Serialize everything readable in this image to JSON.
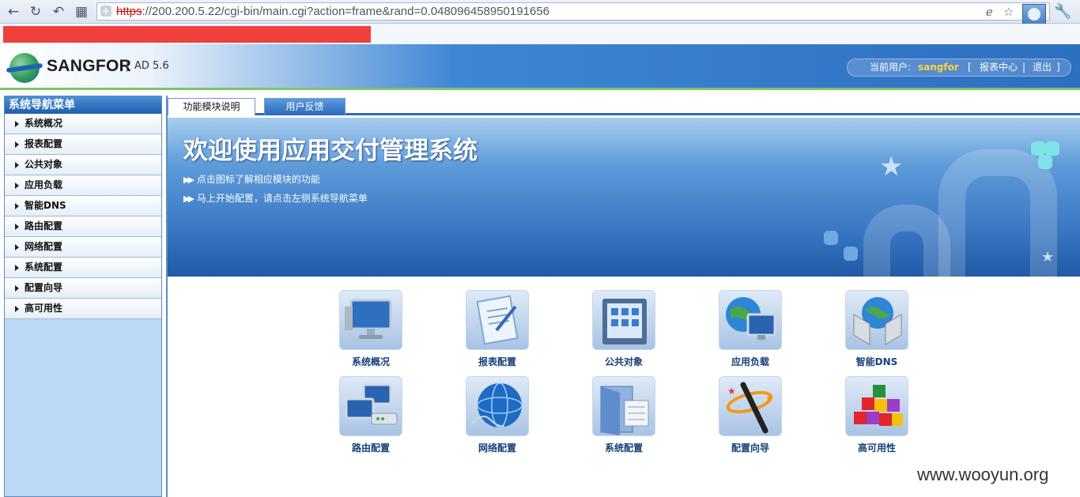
{
  "browser": {
    "url_scheme": "https",
    "url_rest": "://200.200.5.22/cgi-bin/main.cgi?action=frame&rand=0.048096458950191656"
  },
  "header": {
    "brand": "SANGFOR",
    "version": "AD 5.6",
    "current_user_label": "当前用户:",
    "username": "sangfor",
    "bracket_open": "[",
    "report_center": "报表中心",
    "separator": "|",
    "logout": "退出",
    "bracket_close": "]"
  },
  "sidebar": {
    "title": "系统导航菜单",
    "items": [
      {
        "label": "系统概况"
      },
      {
        "label": "报表配置"
      },
      {
        "label": "公共对象"
      },
      {
        "label": "应用负载"
      },
      {
        "label": "智能DNS"
      },
      {
        "label": "路由配置"
      },
      {
        "label": "网络配置"
      },
      {
        "label": "系统配置"
      },
      {
        "label": "配置向导"
      },
      {
        "label": "高可用性"
      }
    ]
  },
  "tabs": [
    {
      "label": "功能模块说明",
      "active": true
    },
    {
      "label": "用户反馈",
      "active": false
    }
  ],
  "banner": {
    "title": "欢迎使用应用交付管理系统",
    "lines": [
      "点击图标了解相应模块的功能",
      "马上开始配置，请点击左侧系统导航菜单"
    ]
  },
  "modules": [
    {
      "label": "系统概况",
      "icon": "monitor-icon"
    },
    {
      "label": "报表配置",
      "icon": "report-icon"
    },
    {
      "label": "公共对象",
      "icon": "objects-icon"
    },
    {
      "label": "应用负载",
      "icon": "globe-monitor-icon"
    },
    {
      "label": "智能DNS",
      "icon": "dns-server-icon"
    },
    {
      "label": "路由配置",
      "icon": "router-icon"
    },
    {
      "label": "网络配置",
      "icon": "network-globe-icon"
    },
    {
      "label": "系统配置",
      "icon": "system-config-icon"
    },
    {
      "label": "配置向导",
      "icon": "wizard-wand-icon"
    },
    {
      "label": "高可用性",
      "icon": "blocks-icon"
    }
  ],
  "watermark": "www.wooyun.org",
  "colors": {
    "accent_blue": "#2c6bbd",
    "username_yellow": "#ffd23a",
    "redaction_red": "#f0403b"
  }
}
